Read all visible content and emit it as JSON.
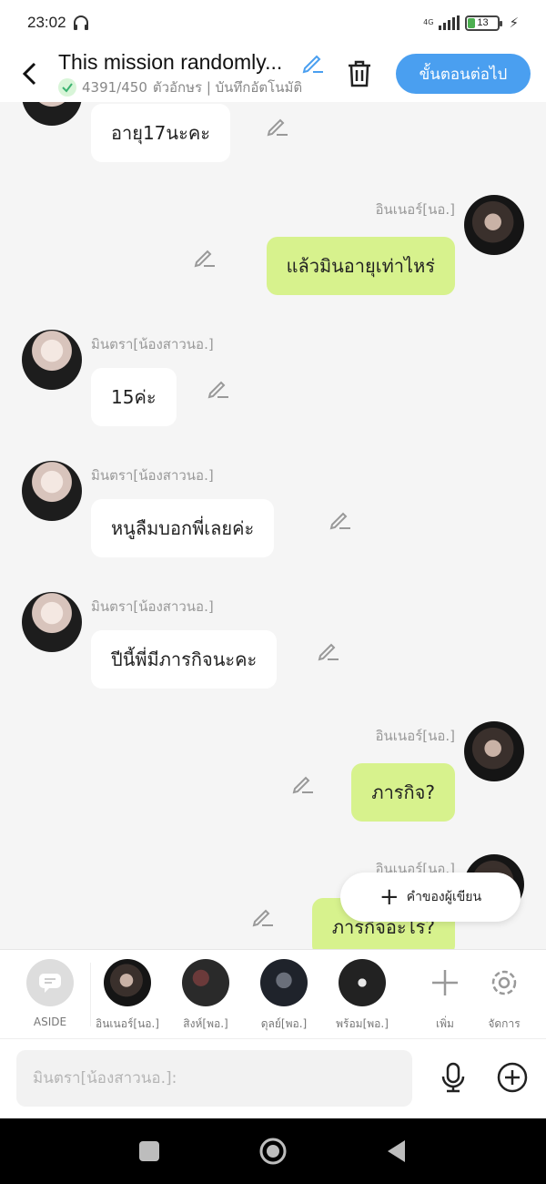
{
  "status": {
    "time": "23:02",
    "network": "4G",
    "battery": "13"
  },
  "header": {
    "title": "This mission randomly...",
    "count": "4391/450",
    "subtitle": "ตัวอักษร | บันทึกอัตโนมัติ",
    "next_label": "ขั้นตอนต่อไป"
  },
  "messages": [
    {
      "side": "left",
      "sender": "",
      "text": "อายุ17นะคะ"
    },
    {
      "side": "right",
      "sender": "อินเนอร์[นอ.]",
      "text": "แล้วมินอายุเท่าไหร่"
    },
    {
      "side": "left",
      "sender": "มินตรา[น้องสาวนอ.]",
      "text": "15ค่ะ"
    },
    {
      "side": "left",
      "sender": "มินตรา[น้องสาวนอ.]",
      "text": "หนูลืมบอกพี่เลยค่ะ"
    },
    {
      "side": "left",
      "sender": "มินตรา[น้องสาวนอ.]",
      "text": "ปีนี้พี่มีภารกิจนะคะ"
    },
    {
      "side": "right",
      "sender": "อินเนอร์[นอ.]",
      "text": "ภารกิจ?"
    },
    {
      "side": "right",
      "sender": "อินเนอร์[นอ.]",
      "text": "ภารกิจอะไร?"
    }
  ],
  "fab": {
    "label": "คำของผู้เขียน"
  },
  "characters": {
    "aside": "ASIDE",
    "items": [
      "อินเนอร์[นอ.]",
      "สิงห์[พอ.]",
      "ดุลย์[พอ.]",
      "พร้อม[พอ.]"
    ],
    "add_label": "เพิ่ม",
    "manage_label": "จัดการ"
  },
  "input": {
    "placeholder": "มินตรา[น้องสาวนอ.]:"
  },
  "colors": {
    "accent": "#4a9ff0",
    "right_bubble": "#d7f28d",
    "left_bubble": "#ffffff"
  }
}
